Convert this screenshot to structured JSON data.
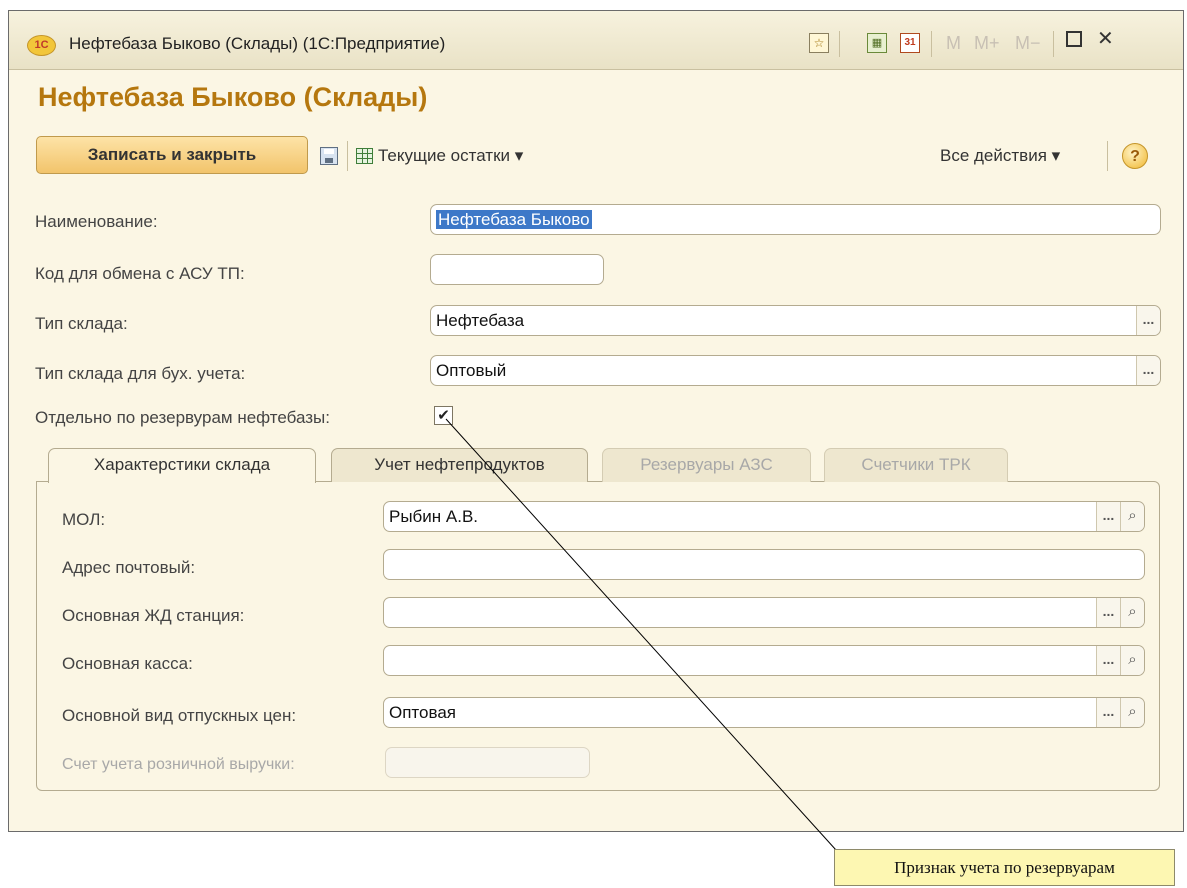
{
  "window": {
    "logo": "1C",
    "title": "Нефтебаза Быково (Склады)  (1С:Предприятие)",
    "m_buttons": [
      "M",
      "M+",
      "M−"
    ],
    "close_glyph": "✕"
  },
  "form": {
    "heading": "Нефтебаза Быково (Склады)",
    "toolbar": {
      "save_close_label": "Записать и закрыть",
      "current_stock_label": "Текущие остатки ▾",
      "all_actions_label": "Все действия ▾",
      "help_glyph": "?"
    },
    "fields": {
      "name_label": "Наименование:",
      "name_value": "Нефтебаза Быково",
      "code_label": "Код для обмена с АСУ ТП:",
      "code_value": "",
      "type_label": "Тип склада:",
      "type_value": "Нефтебаза",
      "acc_type_label": "Тип склада для бух. учета:",
      "acc_type_value": "Оптовый",
      "by_tanks_label": "Отдельно по резервурам нефтебазы:",
      "by_tanks_checked": true
    },
    "tabs": [
      {
        "label": "Характерстики склада",
        "state": "active"
      },
      {
        "label": "Учет нефтепродуктов",
        "state": "inactive"
      },
      {
        "label": "Резервуары АЗС",
        "state": "disabled"
      },
      {
        "label": "Счетчики ТРК",
        "state": "disabled"
      }
    ],
    "tab_fields": {
      "mol_label": "МОЛ:",
      "mol_value": "Рыбин А.В.",
      "address_label": "Адрес почтовый:",
      "address_value": "",
      "station_label": "Основная ЖД станция:",
      "station_value": "",
      "cashbox_label": "Основная касса:",
      "cashbox_value": "",
      "price_type_label": "Основной вид отпускных цен:",
      "price_type_value": "Оптовая",
      "retail_account_label": "Счет учета розничной выручки:",
      "retail_account_value": ""
    },
    "dots_glyph": "...",
    "search_glyph": "🔍"
  },
  "annotation": {
    "text": "Признак учета по резервуарам"
  },
  "colors": {
    "heading": "#b5770e",
    "window_bg": "#fbf6e4",
    "primary_button": "#f2c46b",
    "selection": "#3d78c8",
    "callout_bg": "#fdf7b2"
  }
}
